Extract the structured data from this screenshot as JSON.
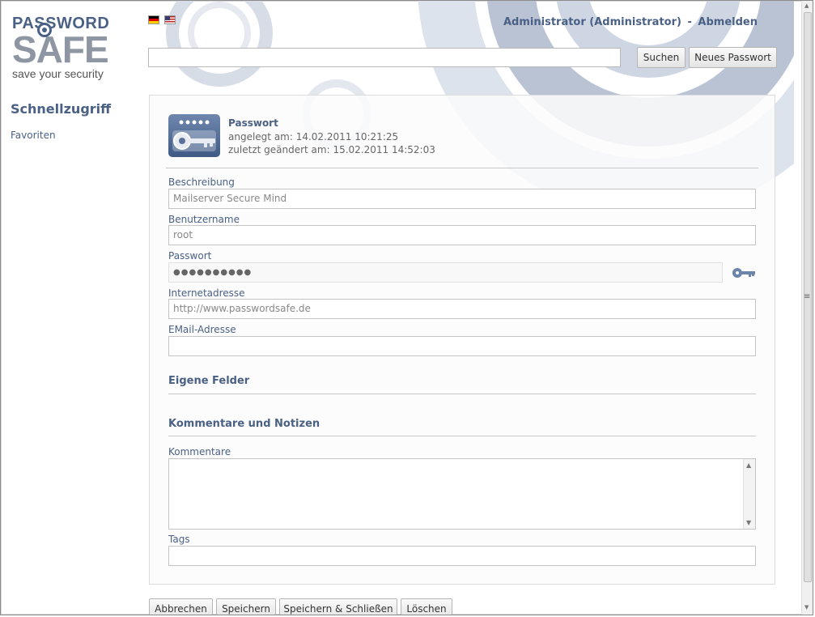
{
  "logo": {
    "line1": "PASSWORD",
    "line2": "SAFE",
    "tagline": "save your security"
  },
  "sidebar": {
    "title": "Schnellzugriff",
    "items": [
      "Favoriten"
    ]
  },
  "header": {
    "user": "Administrator (Administrator)",
    "separator": "-",
    "logout": "Abmelden",
    "languages": [
      "flag-de-icon",
      "flag-us-icon"
    ]
  },
  "search": {
    "value": "",
    "placeholder": "",
    "button": "Suchen",
    "new_password": "Neues Passwort"
  },
  "entry": {
    "icon": "key-icon",
    "title": "Passwort",
    "created": "angelegt am: 14.02.2011 10:21:25",
    "modified": "zuletzt geändert am: 15.02.2011 14:52:03"
  },
  "fields": {
    "description": {
      "label": "Beschreibung",
      "value": "Mailserver Secure Mind"
    },
    "username": {
      "label": "Benutzername",
      "value": "root"
    },
    "password": {
      "label": "Passwort",
      "value": "●●●●●●●●●●"
    },
    "url": {
      "label": "Internetadresse",
      "value": "http://www.passwordsafe.de"
    },
    "email": {
      "label": "EMail-Adresse",
      "value": ""
    }
  },
  "sections": {
    "custom": "Eigene Felder",
    "comments": "Kommentare und Notizen"
  },
  "comments": {
    "label": "Kommentare",
    "value": ""
  },
  "tags": {
    "label": "Tags",
    "value": ""
  },
  "actions": {
    "cancel": "Abbrechen",
    "save": "Speichern",
    "save_close": "Speichern & Schließen",
    "delete": "Löschen"
  },
  "colors": {
    "accent": "#4a6085",
    "muted": "#8e96a3"
  }
}
